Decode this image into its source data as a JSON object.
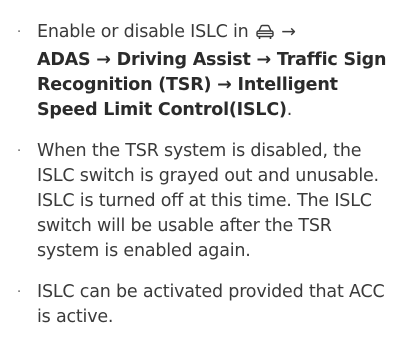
{
  "bullets": [
    {
      "prefix": "Enable or disable ISLC in ",
      "icon": "car-settings-icon",
      "arrow_after_icon": " →",
      "path": "ADAS → Driving Assist → Traffic Sign Recognition (TSR) → Intelligent Speed Limit Control(ISLC)",
      "suffix": "."
    },
    {
      "text": "When the TSR system is disabled, the ISLC switch is grayed out and unusable. ISLC is turned off at this time. The ISLC switch will be usable after the TSR system is enabled again."
    },
    {
      "text": "ISLC can be activated provided that ACC is active."
    }
  ],
  "bullet_glyph": "·"
}
